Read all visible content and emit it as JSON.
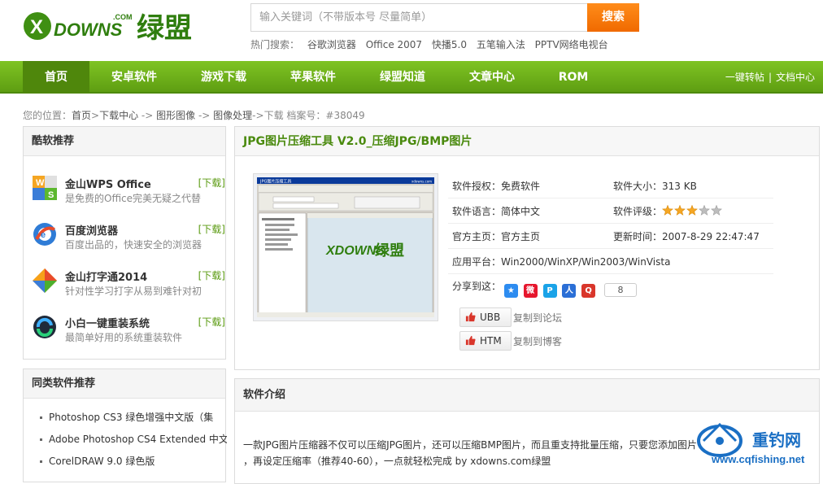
{
  "header": {
    "search_placeholder": "输入关键词（不带版本号  尽量简单）",
    "search_button": "搜索",
    "hot_label": "热门搜索：",
    "hot_links": [
      "谷歌浏览器",
      "Office 2007",
      "快播5.0",
      "五笔输入法",
      "PPTV网络电视台"
    ]
  },
  "nav": {
    "items": [
      "首页",
      "安卓软件",
      "游戏下载",
      "苹果软件",
      "绿盟知道",
      "文章中心",
      "ROM"
    ],
    "active_index": 0,
    "right_links": [
      "一键转帖",
      "文档中心"
    ],
    "right_sep": "|"
  },
  "breadcrumb": {
    "prefix": "您的位置：",
    "crumbs": [
      "首页",
      ">",
      "下载中心",
      " -> ",
      "图形图像",
      " -> ",
      "图像处理",
      "->",
      "下载"
    ],
    "archive": " 档案号：#38049"
  },
  "left_top": {
    "title": "酷软推荐",
    "items": [
      {
        "name": "金山WPS Office",
        "desc": "是免费的Office完美无疑之代替",
        "dl": "[下载]",
        "icon": "wps-icon"
      },
      {
        "name": "百度浏览器",
        "desc": "百度出品的，快速安全的浏览器",
        "dl": "[下载]",
        "icon": "baidu-browser-icon"
      },
      {
        "name": "金山打字通2014",
        "desc": "针对性学习打字从易到难针对初",
        "dl": "[下载]",
        "icon": "typing-icon"
      },
      {
        "name": "小白一键重装系统",
        "desc": "最简单好用的系统重装软件",
        "dl": "[下载]",
        "icon": "reinstall-icon"
      }
    ]
  },
  "left_bottom": {
    "title": "同类软件推荐",
    "items": [
      "Photoshop CS3 绿色增强中文版（集",
      "Adobe Photoshop CS4 Extended 中文",
      "CorelDRAW 9.0 绿色版"
    ]
  },
  "main": {
    "title": "JPG图片压缩工具 V2.0_压缩JPG/BMP图片",
    "license_label": "软件授权：",
    "license": "免费软件",
    "size_label": "软件大小：",
    "size": "313 KB",
    "lang_label": "软件语言：",
    "lang": "简体中文",
    "rating_label": "软件评级：",
    "rating": 3,
    "rating_max": 5,
    "home_label": "官方主页：",
    "home": "官方主页",
    "update_label": "更新时间：",
    "update": "2007-8-29 22:47:47",
    "platform_label": "应用平台：",
    "platform": "Win2000/WinXP/Win2003/WinVista",
    "share_label": "分享到这：",
    "share_count": "8",
    "ubb": "UBB",
    "ubb_action": "复制到论坛",
    "html": "HTM",
    "html_action": "复制到博客"
  },
  "screenshot": {
    "window_title": "JPG图片压缩工具",
    "site": "xdowns.com"
  },
  "intro": {
    "title": "软件介绍",
    "line1": "一款JPG图片压缩器不仅可以压缩JPG图片，还可以压缩BMP图片，而且重支持批量压缩，只要您添加图片",
    "line2": "，再设定压缩率（推荐40-60），一点就轻松完成 by xdowns.com绿盟"
  },
  "watermark": {
    "text": "重钓网",
    "url": "www.cqfishing.net"
  },
  "colors": {
    "nav_green": "#6aae18",
    "nav_active": "#4f870c",
    "accent_orange": "#f27b00",
    "title_green": "#4a8a0e"
  }
}
